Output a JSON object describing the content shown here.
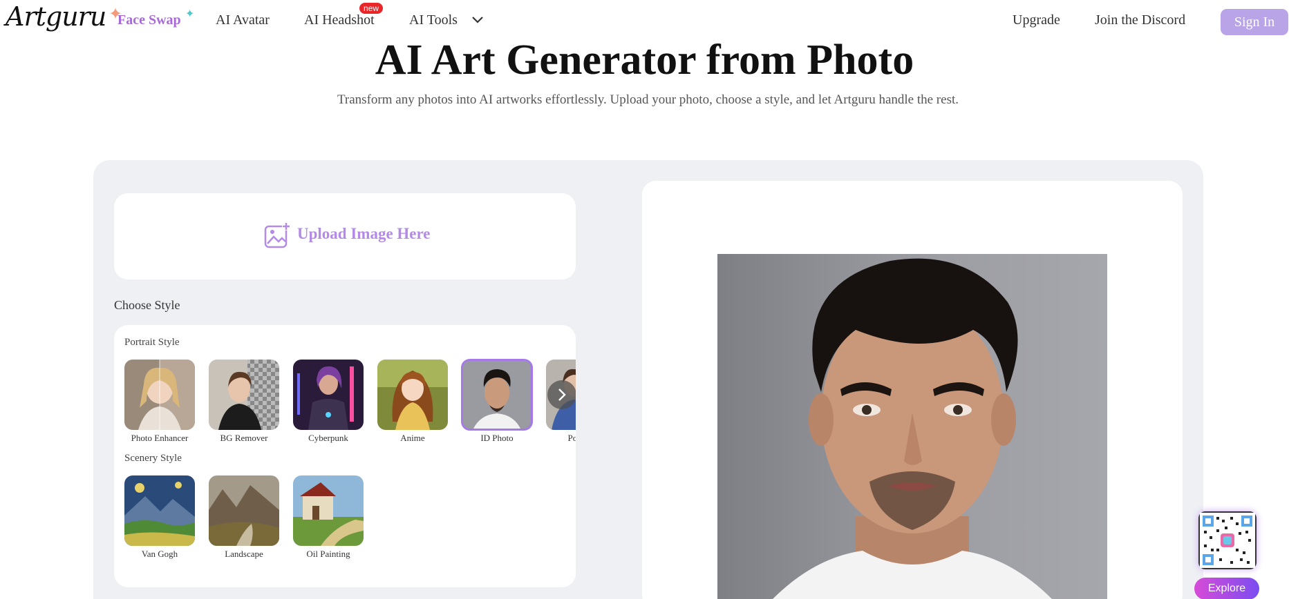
{
  "header": {
    "logo": "Artguru",
    "nav": {
      "face_swap": "Face Swap",
      "ai_avatar": "AI Avatar",
      "ai_headshot": "AI Headshot",
      "new_badge": "new",
      "ai_tools": "AI Tools",
      "upgrade": "Upgrade",
      "discord": "Join the Discord"
    },
    "signin": "Sign In"
  },
  "hero": {
    "title": "AI Art Generator from Photo",
    "subtitle": "Transform any photos into AI artworks effortlessly. Upload your photo, choose a style, and let Artguru handle the rest."
  },
  "upload": {
    "label": "Upload Image Here"
  },
  "styles": {
    "heading": "Choose Style",
    "portrait_label": "Portrait Style",
    "portrait": [
      {
        "label": "Photo Enhancer"
      },
      {
        "label": "BG Remover"
      },
      {
        "label": "Cyberpunk"
      },
      {
        "label": "Anime"
      },
      {
        "label": "ID Photo",
        "selected": true
      },
      {
        "label": "Portrait"
      }
    ],
    "scenery_label": "Scenery Style",
    "scenery": [
      {
        "label": "Van Gogh"
      },
      {
        "label": "Landscape"
      },
      {
        "label": "Oil Painting"
      }
    ]
  },
  "floating": {
    "explore": "Explore"
  },
  "colors": {
    "accent": "#a57ae8",
    "signin_bg": "#b9a4e8",
    "panel_bg": "#eef0f4",
    "badge_red": "#e8262a"
  }
}
